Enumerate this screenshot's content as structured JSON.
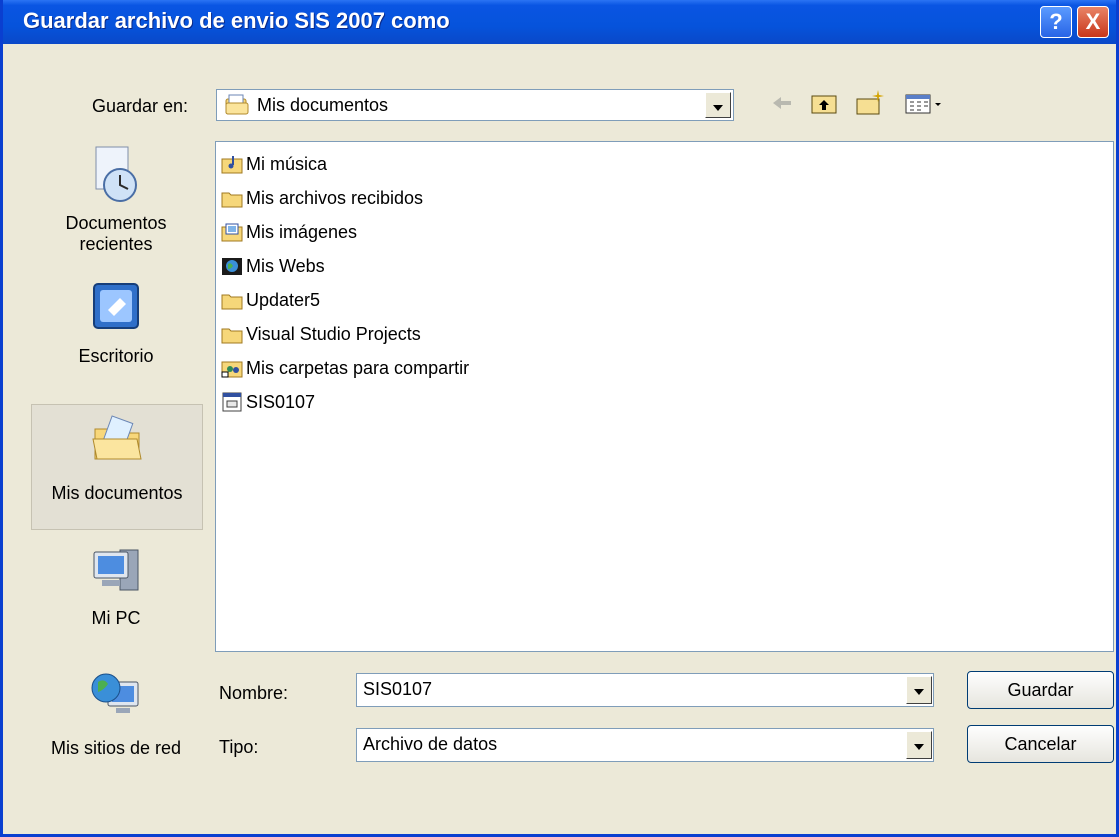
{
  "title": "Guardar archivo de envio SIS 2007 como",
  "titlebar_buttons": {
    "help": "?",
    "close": "X"
  },
  "save_in": {
    "label": "Guardar en:",
    "value": "Mis documentos"
  },
  "places": [
    {
      "label": "Documentos recientes"
    },
    {
      "label": "Escritorio"
    },
    {
      "label": "Mis documentos",
      "selected": true
    },
    {
      "label": "Mi PC"
    },
    {
      "label": "Mis sitios de red"
    }
  ],
  "files": [
    {
      "name": "Mi música",
      "icon": "music-folder-icon"
    },
    {
      "name": "Mis archivos recibidos",
      "icon": "folder-icon"
    },
    {
      "name": "Mis imágenes",
      "icon": "pictures-folder-icon"
    },
    {
      "name": "Mis Webs",
      "icon": "web-folder-icon"
    },
    {
      "name": "Updater5",
      "icon": "folder-icon"
    },
    {
      "name": "Visual Studio Projects",
      "icon": "folder-icon"
    },
    {
      "name": "Mis carpetas para compartir",
      "icon": "shared-folder-icon"
    },
    {
      "name": "SIS0107",
      "icon": "data-file-icon"
    }
  ],
  "filename": {
    "label": "Nombre:",
    "value": "SIS0107"
  },
  "filetype": {
    "label": "Tipo:",
    "value": "Archivo de datos"
  },
  "buttons": {
    "save": "Guardar",
    "cancel": "Cancelar"
  },
  "colors": {
    "titlebar": "#0a55e3",
    "dialog_bg": "#ece9d8",
    "border": "#7f9db9"
  }
}
